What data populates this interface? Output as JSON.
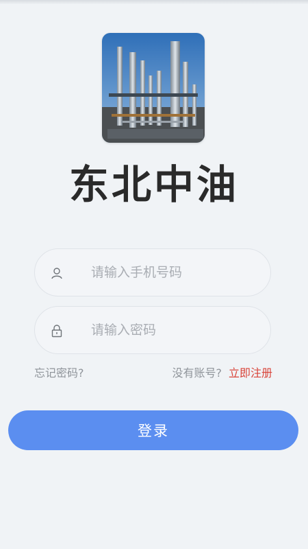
{
  "app": {
    "title": "东北中油"
  },
  "logo": {
    "icon": "refinery-image"
  },
  "form": {
    "phone": {
      "icon": "user-icon",
      "value": "",
      "placeholder": "请输入手机号码"
    },
    "password": {
      "icon": "lock-icon",
      "value": "",
      "placeholder": "请输入密码"
    }
  },
  "links": {
    "forgot_password": "忘记密码?",
    "no_account": "没有账号?",
    "register": "立即注册"
  },
  "actions": {
    "login_label": "登录"
  },
  "colors": {
    "background": "#f0f3f6",
    "primary": "#5b8ef0",
    "register_link": "#d9443a",
    "muted_text": "#8f949a"
  }
}
